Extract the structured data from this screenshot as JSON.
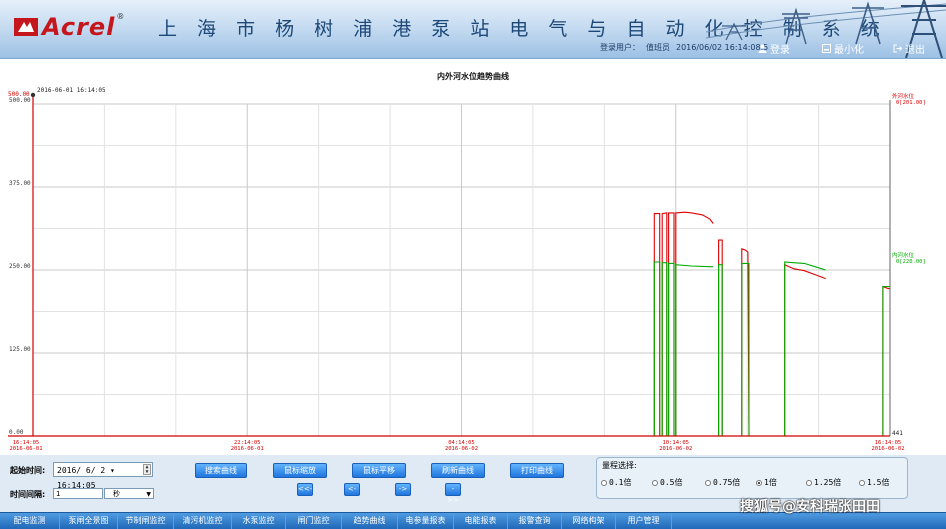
{
  "header": {
    "brand": "Acrel",
    "title": "上 海 市 杨 树 浦 港 泵 站 电 气 与 自 动 化 控 制 系 统",
    "login_user_label": "登录用户：",
    "login_user": "值班员",
    "datetime": "2016/06/02  16:14:08.5",
    "login_label": "登录",
    "minimize_label": "最小化",
    "exit_label": "退出",
    "colors": {
      "brand_red": "#c4161c",
      "title_blue": "#1c4878"
    }
  },
  "chart_data": {
    "type": "line",
    "title": "内外河水位趋势曲线",
    "cursor_label": "2016-06-01 16:14:05",
    "ylim": [
      0,
      500
    ],
    "yticks": [
      "500.00",
      "375.00",
      "250.00",
      "125.00",
      "0.00"
    ],
    "ytick_values": [
      500,
      375,
      250,
      125,
      0
    ],
    "ytop_marker": "500.00",
    "x_range_hours": [
      0,
      24
    ],
    "xticks": [
      {
        "time": "16:14:05",
        "date": "2016-06-01",
        "h": 0
      },
      {
        "time": "22:14:05",
        "date": "2016-06-01",
        "h": 6
      },
      {
        "time": "04:14:05",
        "date": "2016-06-02",
        "h": 12
      },
      {
        "time": "10:14:05",
        "date": "2016-06-02",
        "h": 18
      },
      {
        "time": "16:14:05",
        "date": "2016-06-02",
        "h": 24
      }
    ],
    "end_marker": "441",
    "series": [
      {
        "name": "外河水位",
        "legend_value": "0[201.00]",
        "color": "#e00000",
        "segments": [
          [
            [
              17.4,
              0
            ],
            [
              17.4,
              335
            ],
            [
              17.55,
              335
            ],
            [
              17.55,
              0
            ]
          ],
          [
            [
              17.62,
              0
            ],
            [
              17.62,
              335
            ],
            [
              17.75,
              336
            ],
            [
              17.75,
              0
            ]
          ],
          [
            [
              17.8,
              0
            ],
            [
              17.8,
              336
            ],
            [
              17.95,
              336
            ],
            [
              17.95,
              0
            ]
          ],
          [
            [
              18.0,
              0
            ],
            [
              18.0,
              336
            ],
            [
              18.25,
              337
            ],
            [
              18.45,
              336
            ],
            [
              18.75,
              333
            ],
            [
              18.95,
              327
            ],
            [
              19.05,
              320
            ]
          ],
          [
            [
              19.2,
              0
            ],
            [
              19.2,
              295
            ],
            [
              19.3,
              295
            ],
            [
              19.3,
              0
            ]
          ],
          [
            [
              19.85,
              0
            ],
            [
              19.85,
              282
            ],
            [
              19.95,
              280
            ],
            [
              20.02,
              277
            ],
            [
              20.05,
              0
            ]
          ],
          [
            [
              21.05,
              0
            ],
            [
              21.05,
              258
            ],
            [
              21.3,
              252
            ],
            [
              21.6,
              249
            ],
            [
              21.9,
              243
            ],
            [
              22.2,
              237
            ]
          ],
          [
            [
              23.8,
              0
            ],
            [
              23.8,
              225
            ],
            [
              23.95,
              222
            ],
            [
              24.0,
              222
            ]
          ]
        ]
      },
      {
        "name": "内河水位",
        "legend_value": "0[220.00]",
        "color": "#00aa00",
        "segments": [
          [
            [
              17.4,
              0
            ],
            [
              17.4,
              262
            ],
            [
              17.55,
              262
            ],
            [
              17.55,
              0
            ]
          ],
          [
            [
              17.62,
              0
            ],
            [
              17.62,
              261
            ],
            [
              17.75,
              261
            ],
            [
              17.75,
              0
            ]
          ],
          [
            [
              17.8,
              0
            ],
            [
              17.8,
              260
            ],
            [
              17.95,
              260
            ],
            [
              17.95,
              0
            ]
          ],
          [
            [
              18.0,
              0
            ],
            [
              18.0,
              258
            ],
            [
              18.45,
              256
            ],
            [
              18.95,
              255
            ],
            [
              19.05,
              255
            ]
          ],
          [
            [
              19.2,
              0
            ],
            [
              19.2,
              258
            ],
            [
              19.3,
              258
            ],
            [
              19.3,
              0
            ]
          ],
          [
            [
              19.85,
              0
            ],
            [
              19.85,
              260
            ],
            [
              19.95,
              260
            ],
            [
              20.05,
              260
            ],
            [
              20.05,
              0
            ]
          ],
          [
            [
              21.05,
              0
            ],
            [
              21.05,
              262
            ],
            [
              21.3,
              261
            ],
            [
              21.6,
              260
            ],
            [
              21.9,
              255
            ],
            [
              22.2,
              250
            ]
          ],
          [
            [
              23.8,
              0
            ],
            [
              23.8,
              225
            ],
            [
              23.95,
              225
            ],
            [
              24.0,
              225
            ]
          ]
        ]
      }
    ]
  },
  "controls": {
    "start_time_label": "起始时间:",
    "start_time_value": "2016/ 6/ 2  ▾ 16:14:05",
    "interval_label": "时间间隔:",
    "interval_value": "1",
    "interval_unit": "秒",
    "buttons": {
      "search": "搜索曲线",
      "zoom": "鼠标缩放",
      "pan": "鼠标平移",
      "refresh": "刷新曲线",
      "print": "打印曲线"
    },
    "nav": {
      "first": "<<-",
      "prev": "<-",
      "next": "->",
      "last": "->>"
    },
    "scale_label": "量程选择:",
    "scale_options": [
      "0.1倍",
      "0.5倍",
      "0.75倍",
      "1倍",
      "1.25倍",
      "1.5倍"
    ],
    "scale_selected": "1倍"
  },
  "navbar": {
    "items": [
      "配电监测",
      "泵闸全景图",
      "节制闸监控",
      "清污机监控",
      "水泵监控",
      "闸门监控",
      "趋势曲线",
      "电参量报表",
      "电能报表",
      "报警查询",
      "网络构架",
      "用户管理"
    ]
  },
  "watermark": "搜狐号@安科瑞张田田"
}
